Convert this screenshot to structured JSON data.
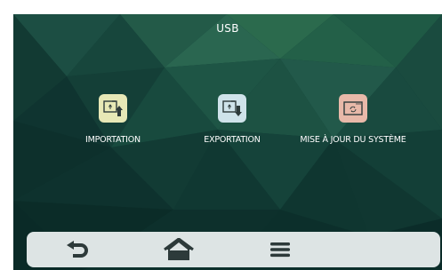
{
  "screen": {
    "title": "USB"
  },
  "apps": [
    {
      "label": "IMPORTATION",
      "icon": "usb-import-icon",
      "tile_color": "#e7e8b6"
    },
    {
      "label": "EXPORTATION",
      "icon": "usb-export-icon",
      "tile_color": "#cfe3ea"
    },
    {
      "label": "MISE À JOUR DU SYSTÈME",
      "icon": "system-update-icon",
      "tile_color": "#e8b9a9"
    }
  ],
  "navbar": {
    "items": [
      {
        "icon": "back-icon"
      },
      {
        "icon": "home-icon"
      },
      {
        "icon": "menu-icon"
      }
    ]
  },
  "colors": {
    "background": "#123a34",
    "navbar": "#dde4e4",
    "icon_dark": "#2d3a3a"
  }
}
